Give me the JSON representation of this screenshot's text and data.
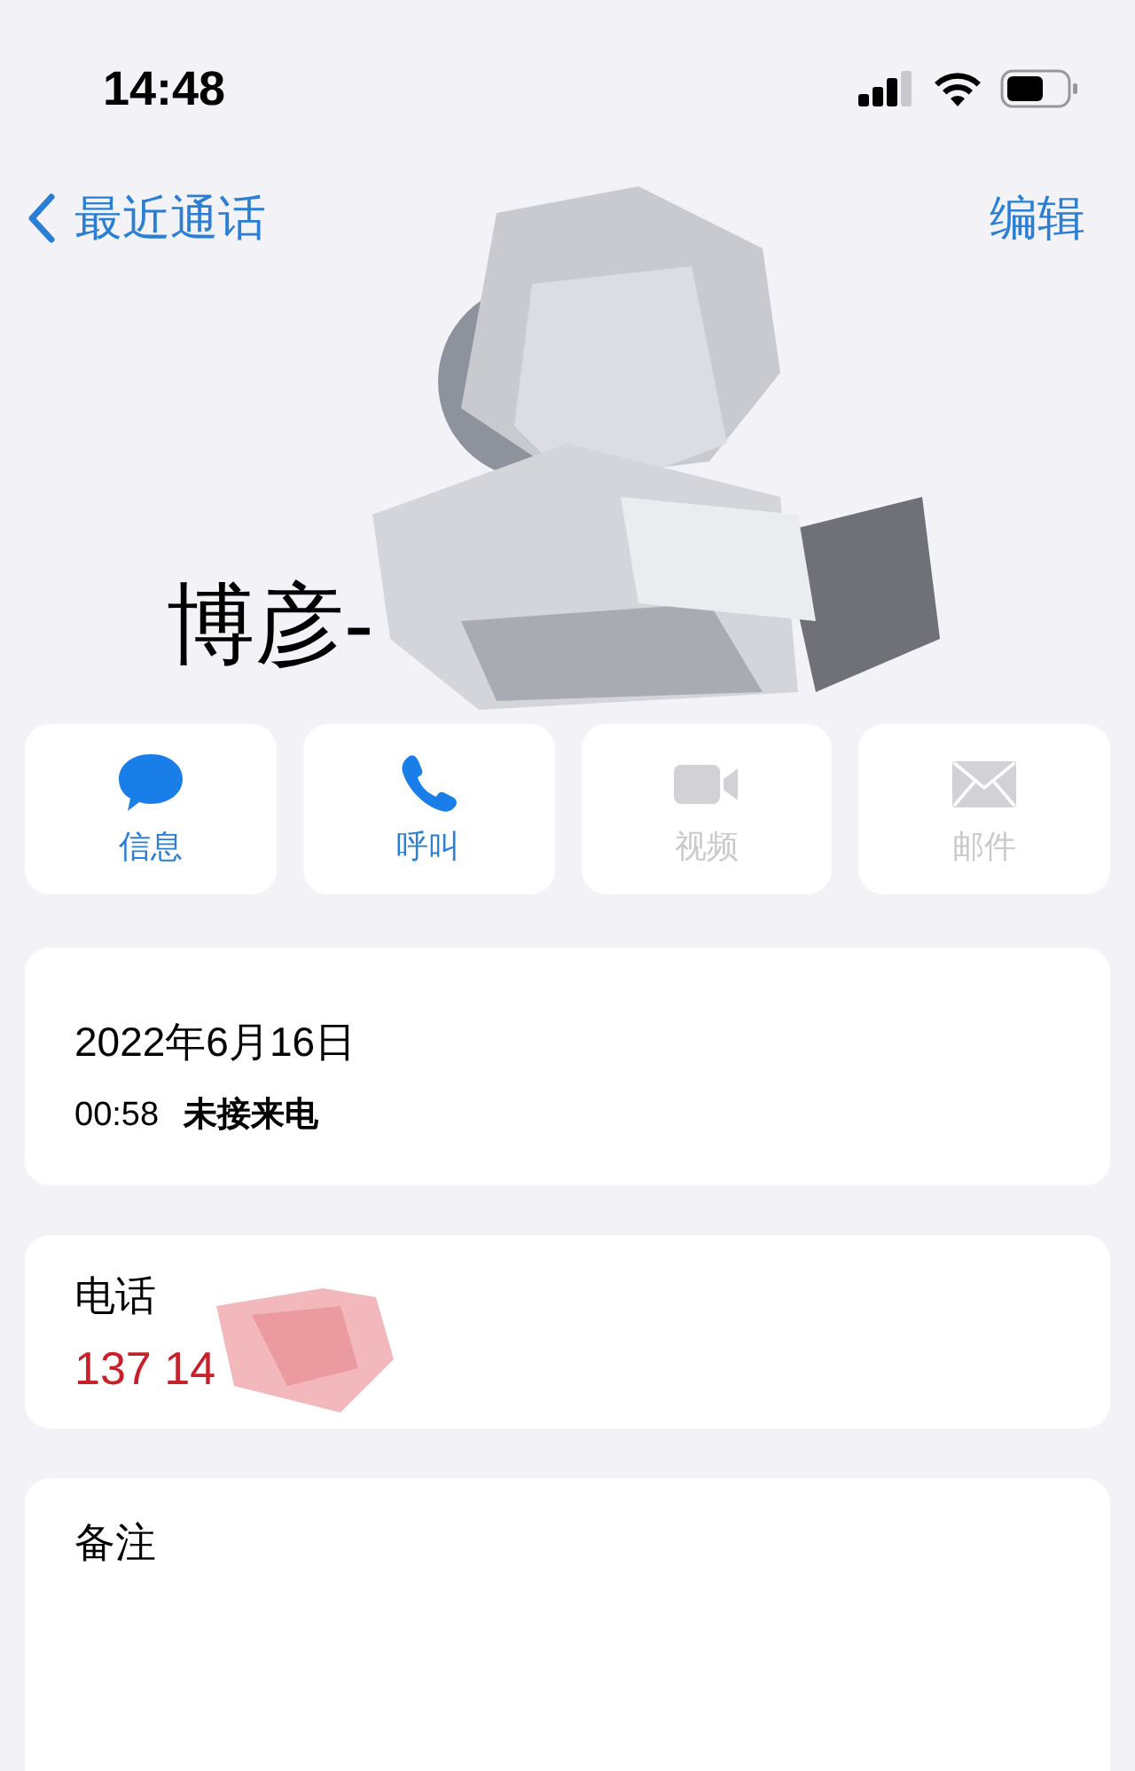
{
  "status_bar": {
    "time": "14:48"
  },
  "nav": {
    "back_label": "最近通话",
    "action": "编辑"
  },
  "contact": {
    "name": "博彦-"
  },
  "actions": [
    {
      "kind": "message",
      "label": "信息",
      "disabled": false
    },
    {
      "kind": "call",
      "label": "呼叫",
      "disabled": false
    },
    {
      "kind": "video",
      "label": "视频",
      "disabled": true
    },
    {
      "kind": "mail",
      "label": "邮件",
      "disabled": true
    }
  ],
  "call_log": {
    "date": "2022年6月16日",
    "time": "00:58",
    "type": "未接来电"
  },
  "phone": {
    "label": "电话",
    "number": "137 14"
  },
  "notes": {
    "label": "备注"
  }
}
